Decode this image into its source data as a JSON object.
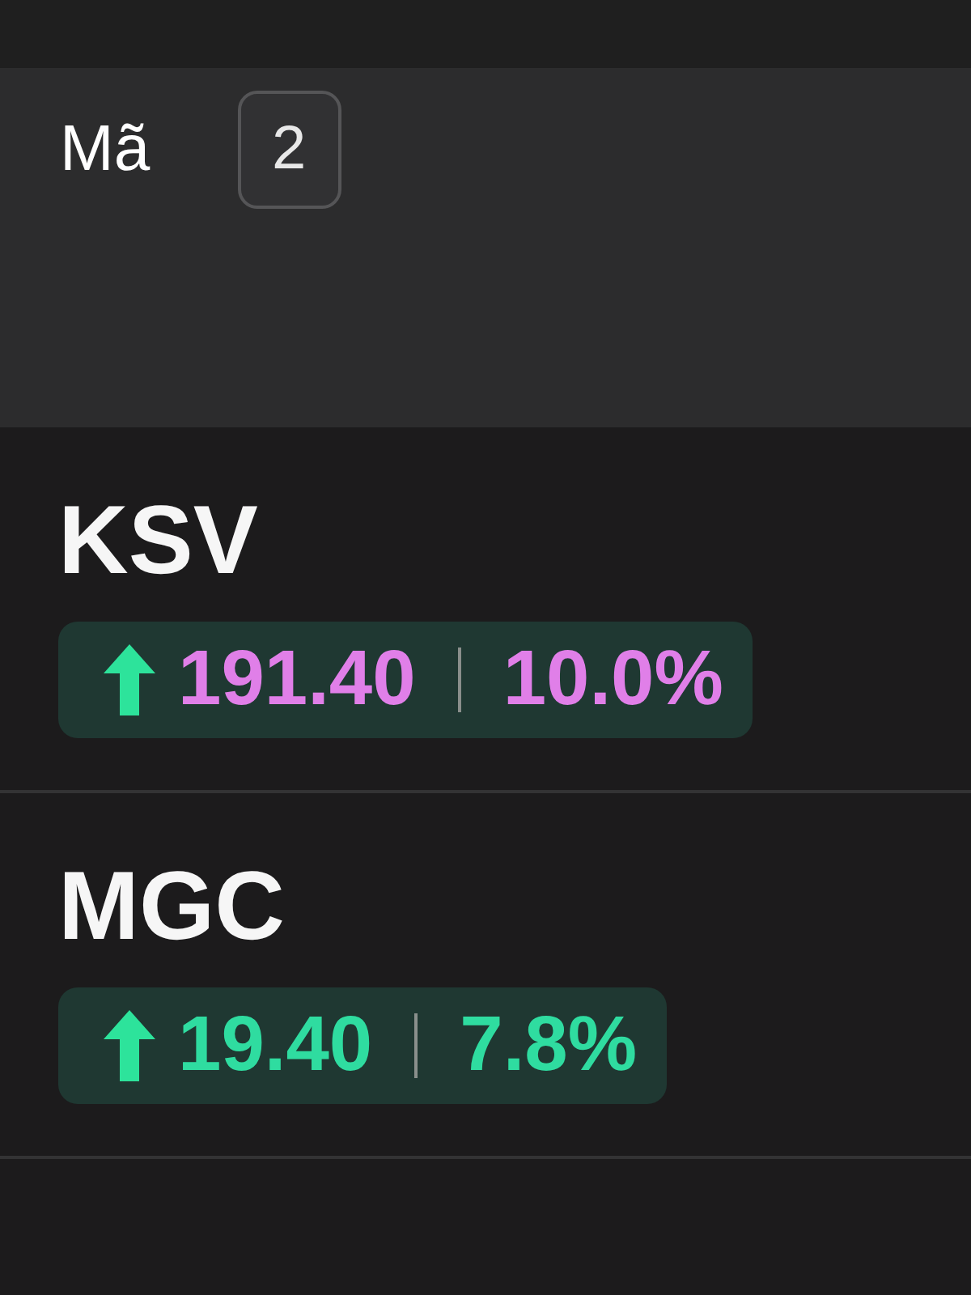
{
  "header": {
    "label": "Mã",
    "count": "2"
  },
  "stocks": [
    {
      "symbol": "KSV",
      "price": "191.40",
      "change": "10.0%",
      "color": "#e07fe8"
    },
    {
      "symbol": "MGC",
      "price": "19.40",
      "change": "7.8%",
      "color": "#2fdca0"
    }
  ]
}
